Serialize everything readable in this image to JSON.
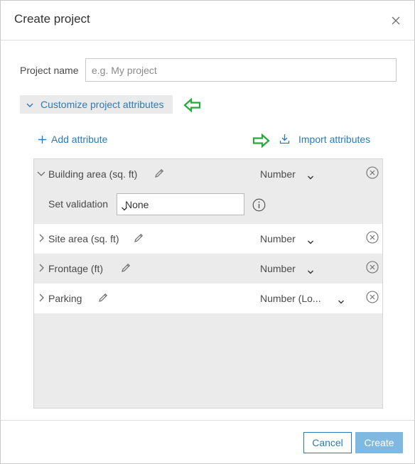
{
  "dialog": {
    "title": "Create project"
  },
  "form": {
    "project_name_label": "Project name",
    "project_name_placeholder": "e.g. My project",
    "project_name_value": ""
  },
  "customize": {
    "label": "Customize project attributes",
    "expanded": true
  },
  "actions": {
    "add_attribute": "Add attribute",
    "import_attributes": "Import attributes"
  },
  "attributes": [
    {
      "name": "Building area (sq. ft)",
      "type": "Number",
      "expanded": true,
      "validation_label": "Set validation",
      "validation_value": "None"
    },
    {
      "name": "Site area (sq. ft)",
      "type": "Number",
      "expanded": false
    },
    {
      "name": "Frontage (ft)",
      "type": "Number",
      "expanded": false
    },
    {
      "name": "Parking",
      "type": "Number (Lo...",
      "expanded": false
    }
  ],
  "footer": {
    "cancel_label": "Cancel",
    "create_label": "Create"
  },
  "colors": {
    "accent": "#2b7bb8",
    "annotation_arrow": "#27a83c",
    "create_disabled": "#7fb8e0"
  }
}
